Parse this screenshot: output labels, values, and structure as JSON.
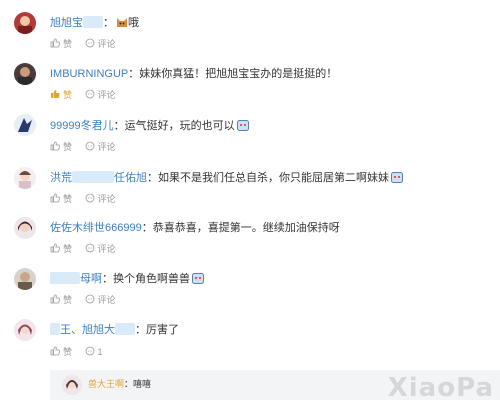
{
  "comments": [
    {
      "name": "旭旭宝",
      "name_tail": "",
      "separator": "：",
      "text": "哦",
      "like_label": "赞",
      "comment_label": "评论",
      "liked": false
    },
    {
      "name": "IMBURNINGUP",
      "separator": "：",
      "text": "妹妹你真猛！把旭旭宝宝办的是挺挺的！",
      "like_label": "赞",
      "comment_label": "评论",
      "liked": true
    },
    {
      "name": "99999冬君儿",
      "separator": "：",
      "text": "运气挺好，玩的也可以",
      "like_label": "赞",
      "comment_label": "评论",
      "liked": false
    },
    {
      "name": "洪荒",
      "name_tail": "任佑旭",
      "separator": "：",
      "text": "如果不是我们任总自杀，你只能屈居第二啊妹妹",
      "like_label": "赞",
      "comment_label": "评论",
      "liked": false
    },
    {
      "name": "佐佐木绯世666999",
      "separator": "：",
      "text": "恭喜恭喜，喜提第一。继续加油保持呀",
      "like_label": "赞",
      "comment_label": "评论",
      "liked": false
    },
    {
      "name": "母啊",
      "separator": "：",
      "text": "换个角色啊兽兽",
      "like_label": "赞",
      "comment_label": "评论",
      "liked": false
    },
    {
      "name": "王、旭旭大",
      "separator": "：",
      "text": "厉害了",
      "like_label": "赞",
      "comment_label": "1",
      "liked": false
    }
  ],
  "reply": {
    "name": "兽大王啊",
    "separator": "：",
    "text": "嘻嘻"
  },
  "watermark": "XiaoPa",
  "colors": {
    "name": "#3d7fbf",
    "liked": "#e0a43a",
    "muted": "#999999",
    "reply_bg": "#f3f4f6"
  }
}
